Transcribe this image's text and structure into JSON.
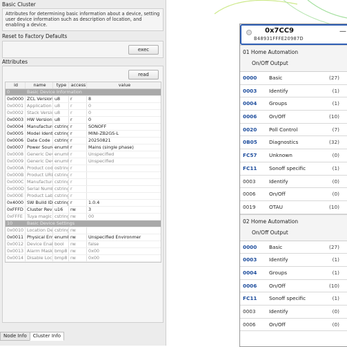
{
  "left_panel": {
    "title": "Basic Cluster",
    "description": "Attributes for determining basic information about a device, setting user device information such as description of location, and enabling a device.",
    "reset_section": "Reset to Factory Defaults",
    "exec_label": "exec",
    "attributes_section": "Attributes",
    "read_label": "read",
    "columns": [
      "id",
      "name",
      "type",
      "access",
      "value"
    ],
    "rows": [
      {
        "kind": "group",
        "id": "0",
        "name": "Basic Device Information"
      },
      {
        "kind": "row",
        "id": "0x0000",
        "name": "ZCL Version",
        "type": "u8",
        "access": "r",
        "value": "8"
      },
      {
        "kind": "dim",
        "id": "0x0001",
        "name": "Application Vers...",
        "type": "u8",
        "access": "r",
        "value": "0"
      },
      {
        "kind": "dim",
        "id": "0x0002",
        "name": "Stack Version",
        "type": "u8",
        "access": "r",
        "value": "0"
      },
      {
        "kind": "row",
        "id": "0x0003",
        "name": "HW Version",
        "type": "u8",
        "access": "r",
        "value": "0"
      },
      {
        "kind": "row",
        "id": "0x0004",
        "name": "Manufacturer N...",
        "type": "cstring",
        "access": "r",
        "value": "SONOFF"
      },
      {
        "kind": "row",
        "id": "0x0005",
        "name": "Model Identifier",
        "type": "cstring",
        "access": "r",
        "value": "MINI-ZB2GS-L"
      },
      {
        "kind": "row",
        "id": "0x0006",
        "name": "Date Code",
        "type": "cstring",
        "access": "r",
        "value": "20250821"
      },
      {
        "kind": "row",
        "id": "0x0007",
        "name": "Power Source",
        "type": "enum8",
        "access": "r",
        "value": "Mains (single phase)"
      },
      {
        "kind": "dim",
        "id": "0x0008",
        "name": "Generic Device ...",
        "type": "enum8",
        "access": "r",
        "value": "Unspecified"
      },
      {
        "kind": "dim",
        "id": "0x0009",
        "name": "Generic Device ...",
        "type": "enum8",
        "access": "r",
        "value": "Unspecified"
      },
      {
        "kind": "dim",
        "id": "0x000A",
        "name": "Product code",
        "type": "ostring",
        "access": "r",
        "value": ""
      },
      {
        "kind": "dim",
        "id": "0x000B",
        "name": "Product URL",
        "type": "cstring",
        "access": "r",
        "value": ""
      },
      {
        "kind": "dim",
        "id": "0x000C",
        "name": "Manufacturer V...",
        "type": "cstring",
        "access": "r",
        "value": ""
      },
      {
        "kind": "dim",
        "id": "0x000D",
        "name": "Serial Number",
        "type": "cstring",
        "access": "r",
        "value": ""
      },
      {
        "kind": "dim",
        "id": "0x000E",
        "name": "Product Label",
        "type": "cstring",
        "access": "r",
        "value": ""
      },
      {
        "kind": "row",
        "id": "0x4000",
        "name": "SW Build ID",
        "type": "cstring",
        "access": "r",
        "value": "1.0.4"
      },
      {
        "kind": "row",
        "id": "0xFFFD",
        "name": "Cluster Revision",
        "type": "u16",
        "access": "rw",
        "value": "3"
      },
      {
        "kind": "dim",
        "id": "0xFFFE",
        "name": "Tuya magic spel...",
        "type": "cstring",
        "access": "rw",
        "value": "00"
      },
      {
        "kind": "group",
        "id": "10",
        "name": "Basic Device Settings"
      },
      {
        "kind": "dim",
        "id": "0x0010",
        "name": "Location Descri...",
        "type": "cstring",
        "access": "rw",
        "value": ""
      },
      {
        "kind": "row",
        "id": "0x0011",
        "name": "Physical Environ...",
        "type": "enum8",
        "access": "rw",
        "value": "Unspecified Environmer"
      },
      {
        "kind": "dim",
        "id": "0x0012",
        "name": "Device Enabled",
        "type": "bool",
        "access": "rw",
        "value": "false"
      },
      {
        "kind": "dim",
        "id": "0x0013",
        "name": "Alarm Mask",
        "type": "bmp8",
        "access": "rw",
        "value": "0x00"
      },
      {
        "kind": "dim",
        "id": "0x0014",
        "name": "Disable Local C...",
        "type": "bmp8",
        "access": "rw",
        "value": "0x00"
      }
    ],
    "tabs": [
      "Node Info",
      "Cluster Info"
    ],
    "active_tab": "Cluster Info"
  },
  "node": {
    "title": "0x7CC9",
    "mac": "B48931FFFE20987D",
    "endpoints": [
      {
        "line1": "01 Home Automation",
        "line2": "On/Off Output",
        "clusters": [
          {
            "id": "0000",
            "name": "Basic",
            "count": "(27)",
            "style": "server"
          },
          {
            "id": "0003",
            "name": "Identify",
            "count": "(1)",
            "style": "server"
          },
          {
            "id": "0004",
            "name": "Groups",
            "count": "(1)",
            "style": "server"
          },
          {
            "id": "0006",
            "name": "On/Off",
            "count": "(10)",
            "style": "server"
          },
          {
            "id": "0020",
            "name": "Poll Control",
            "count": "(7)",
            "style": "server"
          },
          {
            "id": "0B05",
            "name": "Diagnostics",
            "count": "(32)",
            "style": "server"
          },
          {
            "id": "FC57",
            "name": "Unknown",
            "count": "(0)",
            "style": "server"
          },
          {
            "id": "FC11",
            "name": "Sonoff specific",
            "count": "(1)",
            "style": "server"
          },
          {
            "id": "0003",
            "name": "Identify",
            "count": "(0)",
            "style": "client"
          },
          {
            "id": "0006",
            "name": "On/Off",
            "count": "(0)",
            "style": "client"
          },
          {
            "id": "0019",
            "name": "OTAU",
            "count": "(10)",
            "style": "client"
          }
        ]
      },
      {
        "line1": "02 Home Automation",
        "line2": "On/Off Output",
        "clusters": [
          {
            "id": "0000",
            "name": "Basic",
            "count": "(27)",
            "style": "server"
          },
          {
            "id": "0003",
            "name": "Identify",
            "count": "(1)",
            "style": "server"
          },
          {
            "id": "0004",
            "name": "Groups",
            "count": "(1)",
            "style": "server"
          },
          {
            "id": "0006",
            "name": "On/Off",
            "count": "(10)",
            "style": "server"
          },
          {
            "id": "FC11",
            "name": "Sonoff specific",
            "count": "(1)",
            "style": "server"
          },
          {
            "id": "0003",
            "name": "Identify",
            "count": "(0)",
            "style": "client"
          },
          {
            "id": "0006",
            "name": "On/Off",
            "count": "(0)",
            "style": "client"
          }
        ]
      }
    ]
  }
}
